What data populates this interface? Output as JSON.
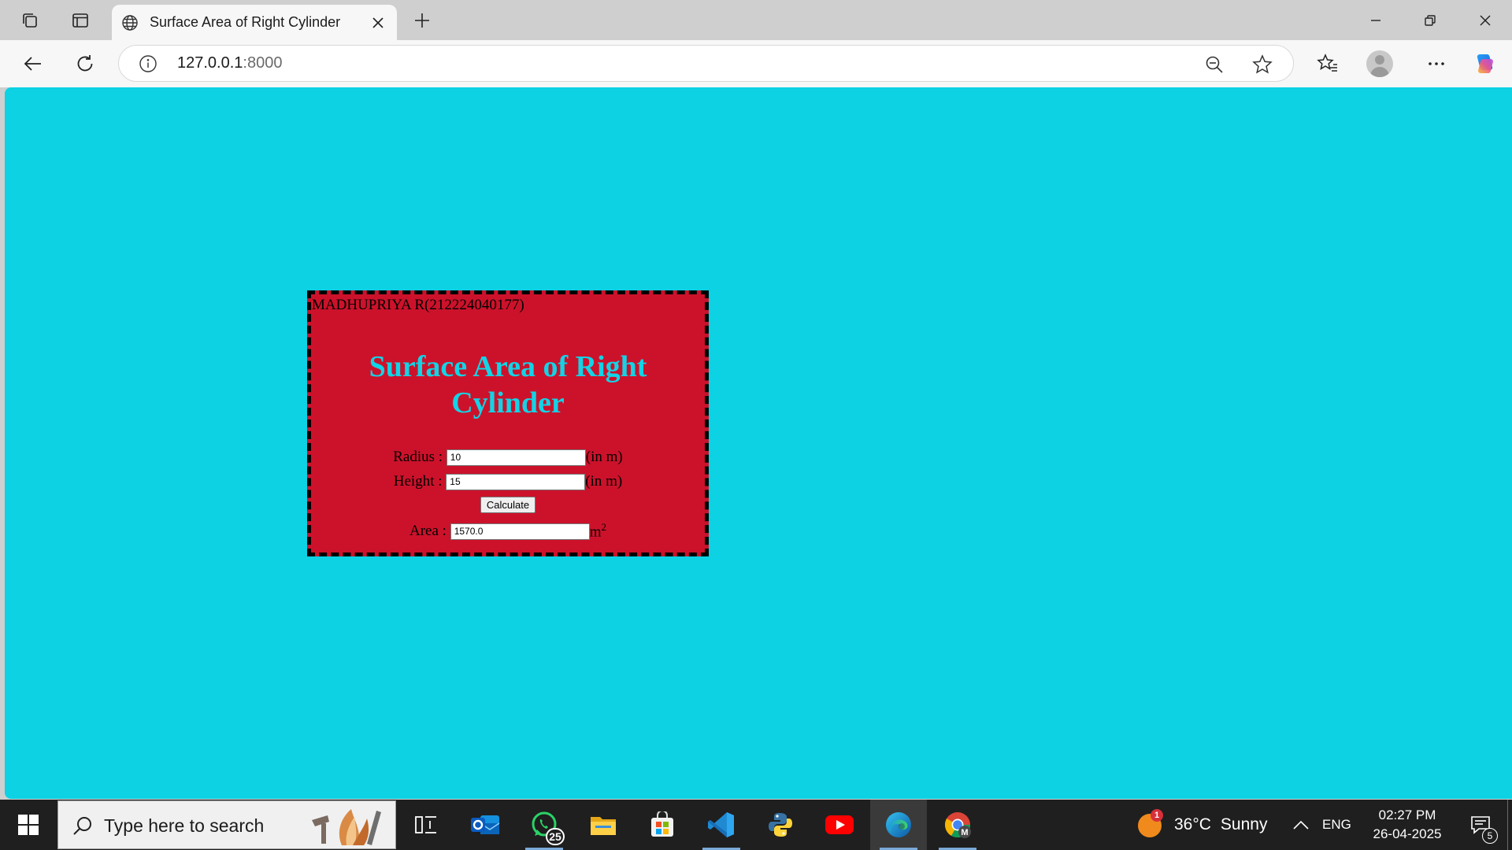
{
  "browser": {
    "tab": {
      "title": "Surface Area of Right Cylinder"
    },
    "address": {
      "host": "127.0.0.1",
      "port": ":8000"
    }
  },
  "page": {
    "background": "#0cd2e4",
    "card_color": "#cc122b",
    "title_color": "#13d3e6",
    "student": "MADHUPRIYA R(212224040177)",
    "title": "Surface Area of Right Cylinder",
    "form": {
      "radius": {
        "label": "Radius : ",
        "value": "10",
        "unit": "(in m)"
      },
      "height": {
        "label": "Height : ",
        "value": "15",
        "unit": "(in m)"
      },
      "calculate_label": "Calculate",
      "area": {
        "label": "Area : ",
        "value": "1570.0",
        "unit": "m",
        "unit_sup": "2"
      }
    }
  },
  "taskbar": {
    "search_placeholder": "Type here to search",
    "whatsapp_badge": "25",
    "chrome_letter": "M",
    "weather": {
      "temp": "36°C",
      "condition": "Sunny",
      "alert_count": "1"
    },
    "language": "ENG",
    "time": "02:27 PM",
    "date": "26-04-2025",
    "notification_count": "5"
  }
}
